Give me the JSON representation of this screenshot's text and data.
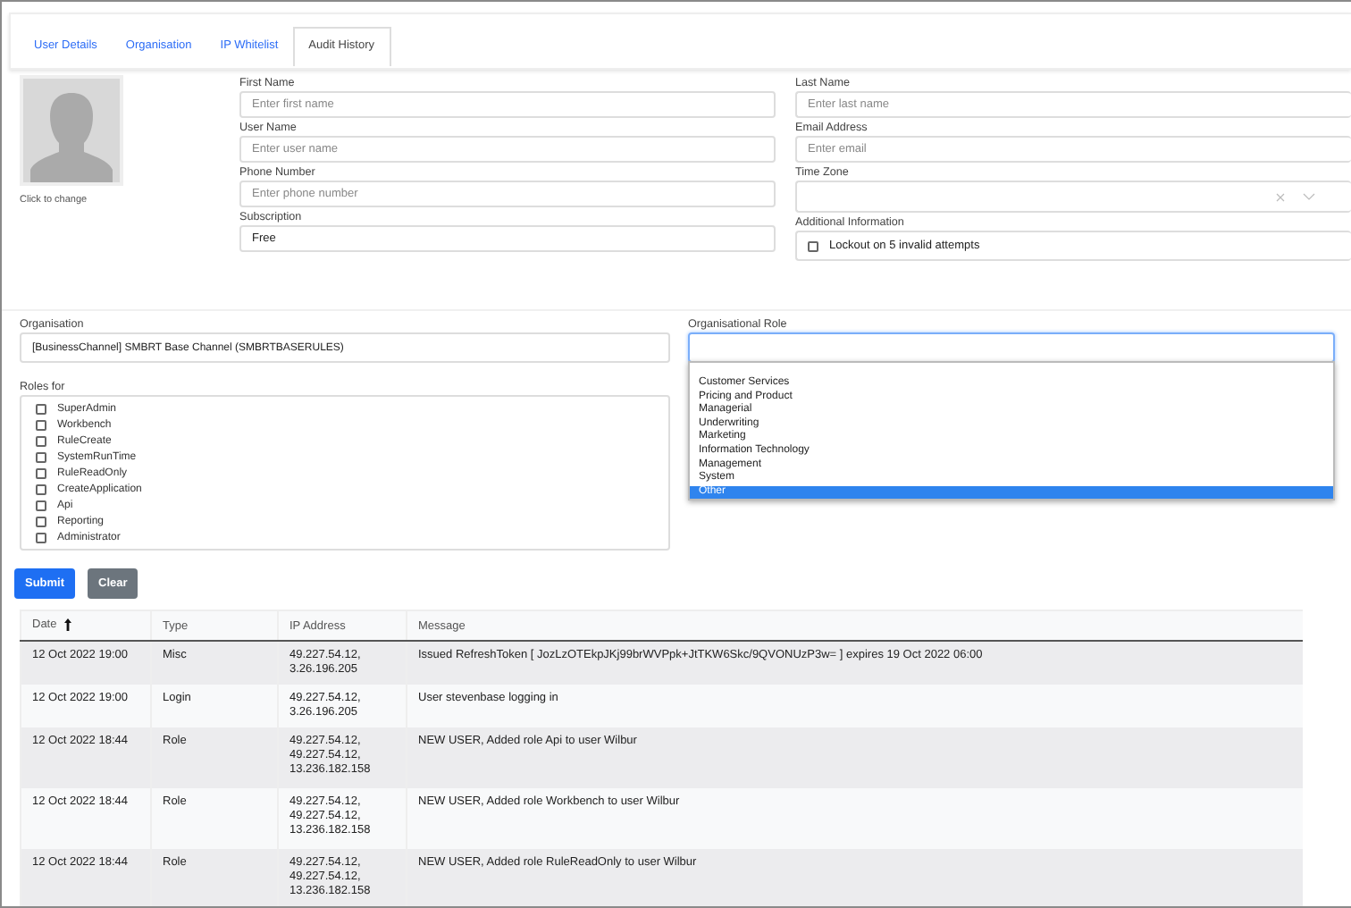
{
  "tabs": [
    {
      "label": "User Details",
      "selected": false
    },
    {
      "label": "Organisation",
      "selected": false
    },
    {
      "label": "IP Whitelist",
      "selected": false
    },
    {
      "label": "Audit History",
      "selected": true
    }
  ],
  "avatar": {
    "caption": "Click to change"
  },
  "fields_left": [
    {
      "label": "First Name",
      "placeholder": "Enter first name"
    },
    {
      "label": "User Name",
      "placeholder": "Enter user name"
    },
    {
      "label": "Phone Number",
      "placeholder": "Enter phone number"
    },
    {
      "label": "Subscription",
      "value": "Free"
    }
  ],
  "fields_right": [
    {
      "label": "Last Name",
      "kind": "text",
      "placeholder": "Enter last name"
    },
    {
      "label": "Email Address",
      "kind": "text",
      "placeholder": "Enter email"
    },
    {
      "label": "Time Zone",
      "kind": "select"
    },
    {
      "label": "Additional Information",
      "kind": "checkbox",
      "option": "Lockout on 5 invalid attempts",
      "checked": false
    }
  ],
  "organisation": {
    "label": "Organisation",
    "value": "[BusinessChannel] SMBRT Base Channel (SMBRTBASERULES)"
  },
  "roles": {
    "label": "Roles for",
    "items": [
      {
        "label": "SuperAdmin",
        "checked": false
      },
      {
        "label": "Workbench",
        "checked": false
      },
      {
        "label": "RuleCreate",
        "checked": false
      },
      {
        "label": "SystemRunTime",
        "checked": false
      },
      {
        "label": "RuleReadOnly",
        "checked": false
      },
      {
        "label": "CreateApplication",
        "checked": false
      },
      {
        "label": "Api",
        "checked": false
      },
      {
        "label": "Reporting",
        "checked": false
      },
      {
        "label": "Administrator",
        "checked": false
      }
    ]
  },
  "organisational_role": {
    "label": "Organisational Role",
    "options": [
      {
        "label": "Customer Services",
        "selected": false
      },
      {
        "label": "Pricing and Product",
        "selected": false
      },
      {
        "label": "Managerial",
        "selected": false
      },
      {
        "label": "Underwriting",
        "selected": false
      },
      {
        "label": "Marketing",
        "selected": false
      },
      {
        "label": "Information Technology",
        "selected": false
      },
      {
        "label": "Management",
        "selected": false
      },
      {
        "label": "System",
        "selected": false
      },
      {
        "label": "Other",
        "selected": true
      }
    ]
  },
  "buttons": [
    {
      "label": "Submit",
      "kind": "primary"
    },
    {
      "label": "Clear",
      "kind": "secondary"
    }
  ],
  "table": {
    "columns": [
      "Date",
      "Type",
      "IP Address",
      "Message"
    ],
    "rows": [
      {
        "date": "12 Oct 2022 19:00",
        "type": "Misc",
        "ip": [
          "49.227.54.12,",
          "3.26.196.205"
        ],
        "message": "Issued RefreshToken [ JozLzOTEkpJKj99brWVPpk+JtTKW6Skc/9QVONUzP3w= ] expires 19 Oct 2022 06:00"
      },
      {
        "date": "12 Oct 2022 19:00",
        "type": "Login",
        "ip": [
          "49.227.54.12,",
          "3.26.196.205"
        ],
        "message": "User stevenbase logging in"
      },
      {
        "date": "12 Oct 2022 18:44",
        "type": "Role",
        "ip": [
          "49.227.54.12,",
          "49.227.54.12,",
          "13.236.182.158"
        ],
        "message": "NEW USER, Added role Api to user Wilbur"
      },
      {
        "date": "12 Oct 2022 18:44",
        "type": "Role",
        "ip": [
          "49.227.54.12,",
          "49.227.54.12,",
          "13.236.182.158"
        ],
        "message": "NEW USER, Added role Workbench to user Wilbur"
      },
      {
        "date": "12 Oct 2022 18:44",
        "type": "Role",
        "ip": [
          "49.227.54.12,",
          "49.227.54.12,",
          "13.236.182.158"
        ],
        "message": "NEW USER, Added role RuleReadOnly to user Wilbur"
      }
    ]
  }
}
